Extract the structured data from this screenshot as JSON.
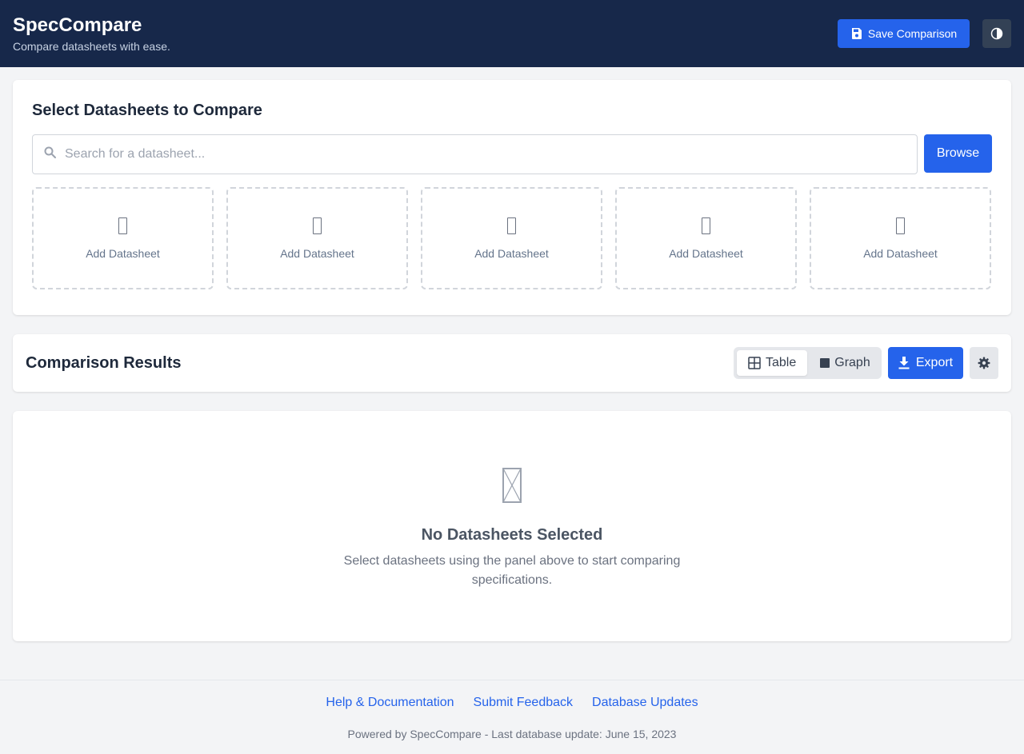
{
  "header": {
    "title": "SpecCompare",
    "subtitle": "Compare datasheets with ease.",
    "save_label": "Save Comparison",
    "save_icon": "save-icon",
    "theme_icon": "half-moon-icon"
  },
  "select_panel": {
    "title": "Select Datasheets to Compare",
    "search": {
      "placeholder": "Search for a datasheet...",
      "value": "",
      "icon": "search-icon"
    },
    "browse_label": "Browse",
    "slots": [
      {
        "label": "Add Datasheet",
        "icon": "missing-glyph-icon"
      },
      {
        "label": "Add Datasheet",
        "icon": "missing-glyph-icon"
      },
      {
        "label": "Add Datasheet",
        "icon": "missing-glyph-icon"
      },
      {
        "label": "Add Datasheet",
        "icon": "missing-glyph-icon"
      },
      {
        "label": "Add Datasheet",
        "icon": "missing-glyph-icon"
      }
    ]
  },
  "results": {
    "title": "Comparison Results",
    "view_toggle": {
      "selected": "Table",
      "options": [
        {
          "label": "Table",
          "icon": "grid-icon"
        },
        {
          "label": "Graph",
          "icon": "square-icon"
        }
      ]
    },
    "export_label": "Export",
    "export_icon": "download-icon",
    "settings_icon": "gear-icon"
  },
  "empty_state": {
    "icon": "missing-glyph-icon",
    "title": "No Datasheets Selected",
    "description": "Select datasheets using the panel above to start comparing specifications."
  },
  "footer": {
    "links": [
      "Help & Documentation",
      "Submit Feedback",
      "Database Updates"
    ],
    "note": "Powered by SpecCompare - Last database update: June 15, 2023"
  },
  "colors": {
    "header_bg": "#17284a",
    "primary": "#2563eb",
    "page_bg": "#f3f4f6"
  }
}
